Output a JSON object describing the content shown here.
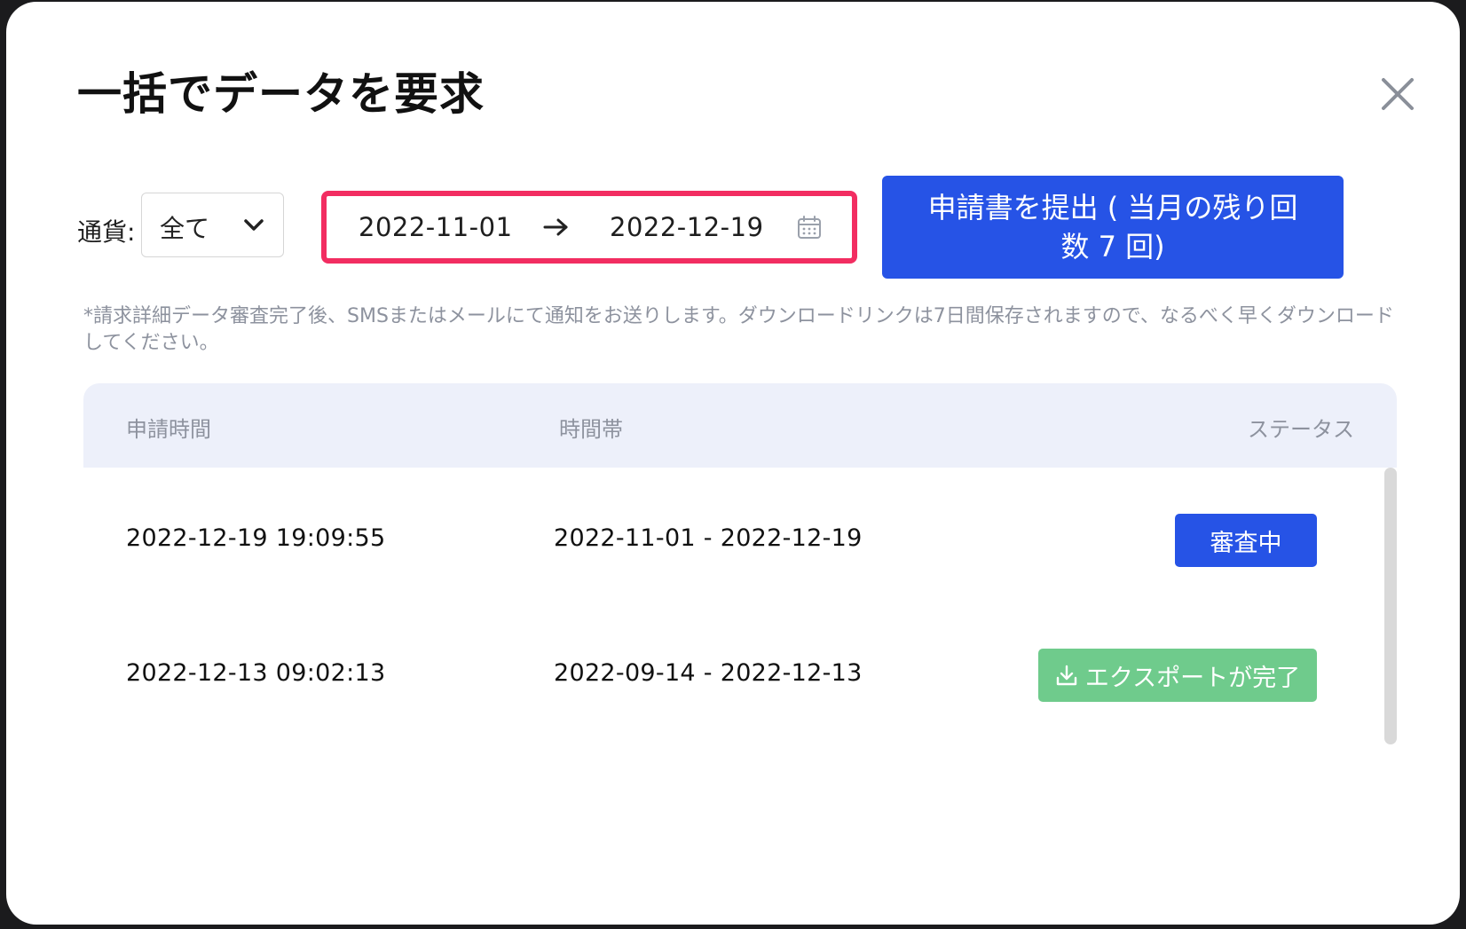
{
  "modal": {
    "title": "一括でデータを要求"
  },
  "filters": {
    "currency_label": "通貨:",
    "currency_value": "全て",
    "range_start": "2022-11-01",
    "range_end": "2022-12-19"
  },
  "submit": {
    "label": "申請書を提出 ( 当月の残り回数 7 回)"
  },
  "note": "*請求詳細データ審査完了後、SMSまたはメールにて通知をお送りします。ダウンロードリンクは7日間保存されますので、なるべく早くダウンロードしてください。",
  "table": {
    "headers": [
      "申請時間",
      "時間帯",
      "ステータス"
    ],
    "rows": [
      {
        "requested_at": "2022-12-19 19:09:55",
        "period": "2022-11-01 - 2022-12-19",
        "status": "審査中"
      },
      {
        "requested_at": "2022-12-13 09:02:13",
        "period": "2022-09-14 - 2022-12-13",
        "status": "エクスポートが完了"
      }
    ]
  },
  "colors": {
    "primary": "#2653e6",
    "highlight_border": "#f22d61",
    "success": "#6fcb8c",
    "header_bg": "#edf0fa"
  },
  "icons": {
    "close": "close-icon",
    "dropdown": "chevron-down-icon",
    "range_arrow": "arrow-right-icon",
    "calendar": "calendar-icon",
    "download": "download-icon"
  }
}
